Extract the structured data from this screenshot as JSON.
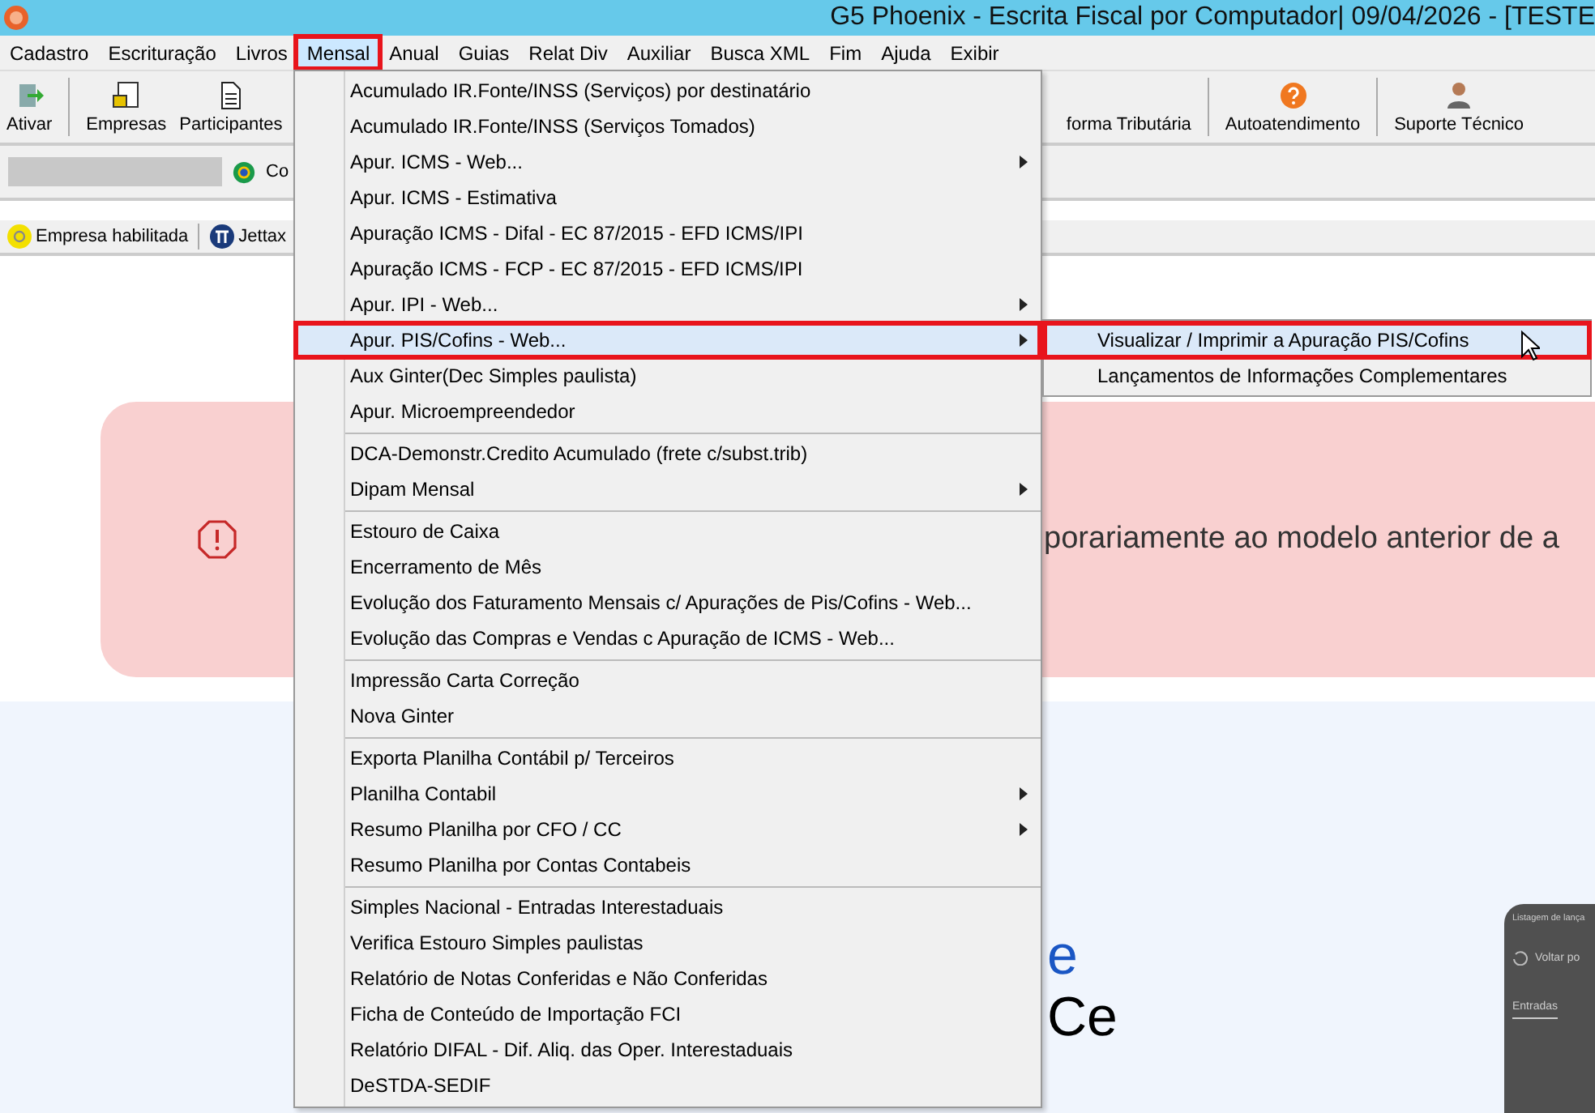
{
  "window": {
    "title": "G5 Phoenix - Escrita Fiscal por Computador|  09/04/2026 - [TESTE"
  },
  "menu_bar": [
    {
      "label": "Cadastro",
      "selected": false,
      "outlined": false
    },
    {
      "label": "Escrituração",
      "selected": false,
      "outlined": false
    },
    {
      "label": "Livros",
      "selected": false,
      "outlined": false
    },
    {
      "label": "Mensal",
      "selected": true,
      "outlined": true
    },
    {
      "label": "Anual",
      "selected": false,
      "outlined": false
    },
    {
      "label": "Guias",
      "selected": false,
      "outlined": false
    },
    {
      "label": "Relat Div",
      "selected": false,
      "outlined": false
    },
    {
      "label": "Auxiliar",
      "selected": false,
      "outlined": false
    },
    {
      "label": "Busca XML",
      "selected": false,
      "outlined": false
    },
    {
      "label": "Fim",
      "selected": false,
      "outlined": false
    },
    {
      "label": "Ajuda",
      "selected": false,
      "outlined": false
    },
    {
      "label": "Exibir",
      "selected": false,
      "outlined": false
    }
  ],
  "toolbar_left": [
    {
      "label": "Ativar"
    },
    {
      "label": "Empresas"
    },
    {
      "label": "Participantes"
    }
  ],
  "toolbar_right": [
    {
      "label": "forma Tributária"
    },
    {
      "label": "Autoatendimento"
    },
    {
      "label": "Suporte Técnico"
    }
  ],
  "company_row": {
    "label": "Co"
  },
  "status_row": [
    {
      "label": "Empresa habilitada"
    },
    {
      "label": "Jettax"
    }
  ],
  "alert": {
    "text": "porariamente ao modelo anterior de a"
  },
  "page": {
    "line_1": "e",
    "line_2": "Ce"
  },
  "side_panel": {
    "title": "Listagem de lança",
    "action": "Voltar po",
    "tab": "Entradas"
  },
  "dropdown": [
    [
      {
        "label": "Acumulado IR.Fonte/INSS (Serviços) por destinatário",
        "has_submenu": false,
        "selected": false,
        "outlined": false
      },
      {
        "label": "Acumulado IR.Fonte/INSS (Serviços Tomados)",
        "has_submenu": false,
        "selected": false,
        "outlined": false
      },
      {
        "label": "Apur. ICMS - Web...",
        "has_submenu": true,
        "selected": false,
        "outlined": false
      },
      {
        "label": "Apur. ICMS - Estimativa",
        "has_submenu": false,
        "selected": false,
        "outlined": false
      },
      {
        "label": "Apuração ICMS - Difal - EC 87/2015 - EFD ICMS/IPI",
        "has_submenu": false,
        "selected": false,
        "outlined": false
      },
      {
        "label": "Apuração ICMS - FCP - EC 87/2015 - EFD ICMS/IPI",
        "has_submenu": false,
        "selected": false,
        "outlined": false
      },
      {
        "label": "Apur. IPI - Web...",
        "has_submenu": true,
        "selected": false,
        "outlined": false
      },
      {
        "label": "Apur. PIS/Cofins - Web...",
        "has_submenu": true,
        "selected": true,
        "outlined": true
      },
      {
        "label": "Aux Ginter(Dec Simples paulista)",
        "has_submenu": false,
        "selected": false,
        "outlined": false
      },
      {
        "label": "Apur. Microempreendedor",
        "has_submenu": false,
        "selected": false,
        "outlined": false
      }
    ],
    [
      {
        "label": "DCA-Demonstr.Credito Acumulado (frete c/subst.trib)",
        "has_submenu": false,
        "selected": false,
        "outlined": false
      },
      {
        "label": "Dipam Mensal",
        "has_submenu": true,
        "selected": false,
        "outlined": false
      }
    ],
    [
      {
        "label": "Estouro de Caixa",
        "has_submenu": false,
        "selected": false,
        "outlined": false
      },
      {
        "label": "Encerramento de Mês",
        "has_submenu": false,
        "selected": false,
        "outlined": false
      },
      {
        "label": "Evolução dos Faturamento Mensais c/ Apurações de Pis/Cofins - Web...",
        "has_submenu": false,
        "selected": false,
        "outlined": false
      },
      {
        "label": "Evolução das Compras e Vendas c Apuração de ICMS - Web...",
        "has_submenu": false,
        "selected": false,
        "outlined": false
      }
    ],
    [
      {
        "label": "Impressão Carta Correção",
        "has_submenu": false,
        "selected": false,
        "outlined": false
      },
      {
        "label": "Nova Ginter",
        "has_submenu": false,
        "selected": false,
        "outlined": false
      }
    ],
    [
      {
        "label": "Exporta Planilha Contábil p/ Terceiros",
        "has_submenu": false,
        "selected": false,
        "outlined": false
      },
      {
        "label": "Planilha Contabil",
        "has_submenu": true,
        "selected": false,
        "outlined": false
      },
      {
        "label": "Resumo Planilha por CFO / CC",
        "has_submenu": true,
        "selected": false,
        "outlined": false
      },
      {
        "label": "Resumo Planilha por Contas Contabeis",
        "has_submenu": false,
        "selected": false,
        "outlined": false
      }
    ],
    [
      {
        "label": "Simples Nacional - Entradas Interestaduais",
        "has_submenu": false,
        "selected": false,
        "outlined": false
      },
      {
        "label": "Verifica Estouro Simples paulistas",
        "has_submenu": false,
        "selected": false,
        "outlined": false
      },
      {
        "label": "Relatório de Notas Conferidas e Não Conferidas",
        "has_submenu": false,
        "selected": false,
        "outlined": false
      },
      {
        "label": "Ficha de Conteúdo de Importação FCI",
        "has_submenu": false,
        "selected": false,
        "outlined": false
      },
      {
        "label": "Relatório DIFAL - Dif. Aliq. das Oper. Interestaduais",
        "has_submenu": false,
        "selected": false,
        "outlined": false
      },
      {
        "label": "DeSTDA-SEDIF",
        "has_submenu": false,
        "selected": false,
        "outlined": false
      }
    ]
  ],
  "submenu": [
    {
      "label": "Visualizar / Imprimir a Apuração PIS/Cofins",
      "selected": true,
      "outlined": true
    },
    {
      "label": "Lançamentos de Informações Complementares",
      "selected": false,
      "outlined": false
    }
  ]
}
